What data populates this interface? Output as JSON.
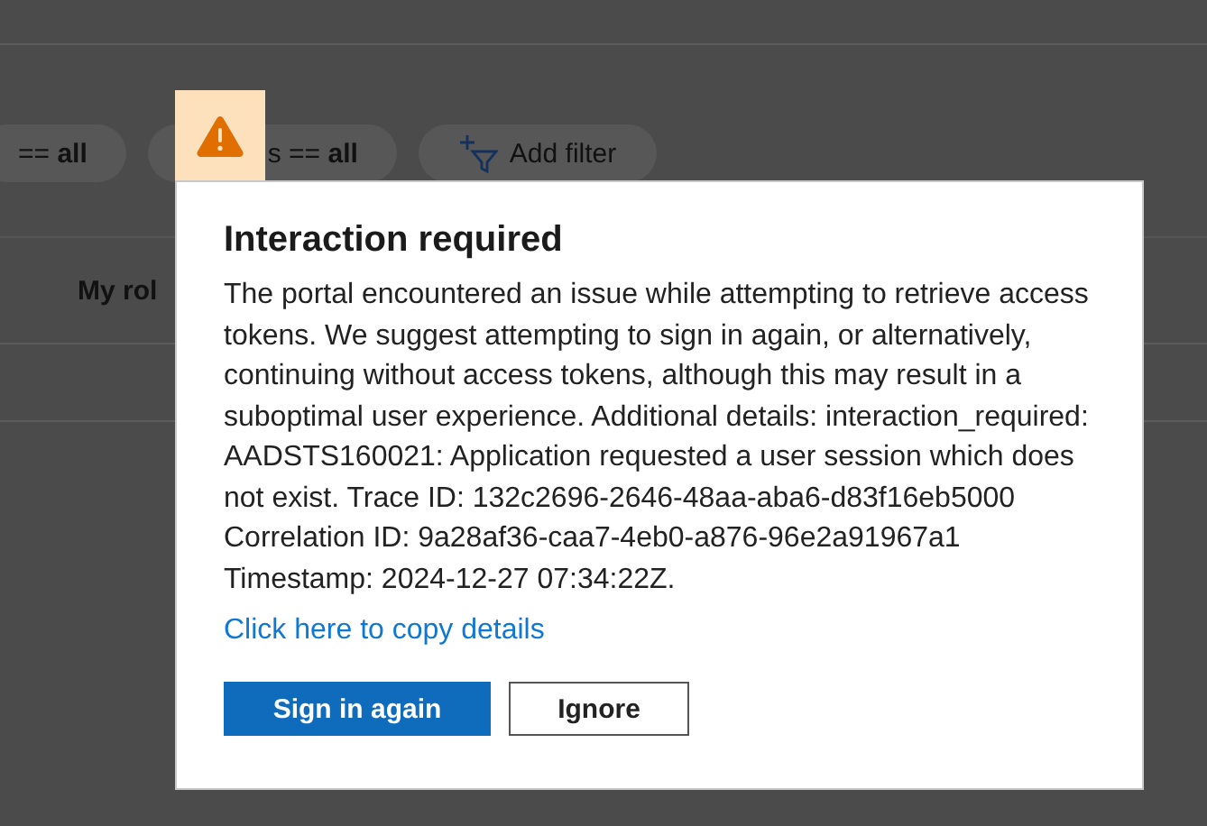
{
  "filters": [
    {
      "value_prefix": "== ",
      "value": "all"
    },
    {
      "value_prefix": "s == ",
      "value": "all"
    }
  ],
  "add_filter": {
    "label": "Add filter"
  },
  "column_header": "My rol",
  "dialog": {
    "title": "Interaction required",
    "message": "The portal encountered an issue while attempting to retrieve access tokens. We suggest attempting to sign in again, or alternatively, continuing without access tokens, although this may result in a suboptimal user experience. Additional details: interaction_required: AADSTS160021: Application requested a user session which does not exist. Trace ID: 132c2696-2646-48aa-aba6-d83f16eb5000 Correlation ID: 9a28af36-caa7-4eb0-a876-96e2a91967a1 Timestamp: 2024-12-27 07:34:22Z.",
    "link": "Click here to copy details",
    "buttons": [
      {
        "label": "Sign in again",
        "kind": "primary"
      },
      {
        "label": "Ignore",
        "kind": "secondary"
      }
    ]
  }
}
